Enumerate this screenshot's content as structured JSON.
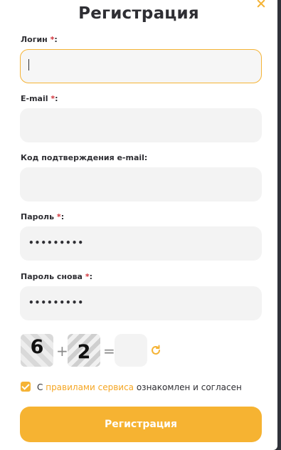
{
  "modal": {
    "title": "Регистрация",
    "close_icon": "close-icon"
  },
  "fields": {
    "login": {
      "label": "Логин",
      "required_mark": "*",
      "label_suffix": ":",
      "value": ""
    },
    "email": {
      "label": "E-mail",
      "required_mark": "*",
      "label_suffix": ":",
      "value": ""
    },
    "email_code": {
      "label": "Код подтверждения e-mail:",
      "value": ""
    },
    "password": {
      "label": "Пароль",
      "required_mark": "*",
      "label_suffix": ":",
      "value": "•••••••••"
    },
    "password_repeat": {
      "label": "Пароль снова",
      "required_mark": "*",
      "label_suffix": ":",
      "value": "•••••••••"
    }
  },
  "captcha": {
    "digit_a": "6",
    "operator": "+",
    "digit_b": "2",
    "equals": "=",
    "answer": "",
    "refresh_icon": "refresh-icon"
  },
  "agreement": {
    "checked": true,
    "prefix": "С",
    "link_text": "правилами сервиса",
    "suffix": "ознакомлен и согласен"
  },
  "submit": {
    "label": "Регистрация"
  },
  "colors": {
    "accent": "#f5b335",
    "required": "#d1333a",
    "text": "#2e2e33",
    "field_bg": "#f3f3f3"
  }
}
